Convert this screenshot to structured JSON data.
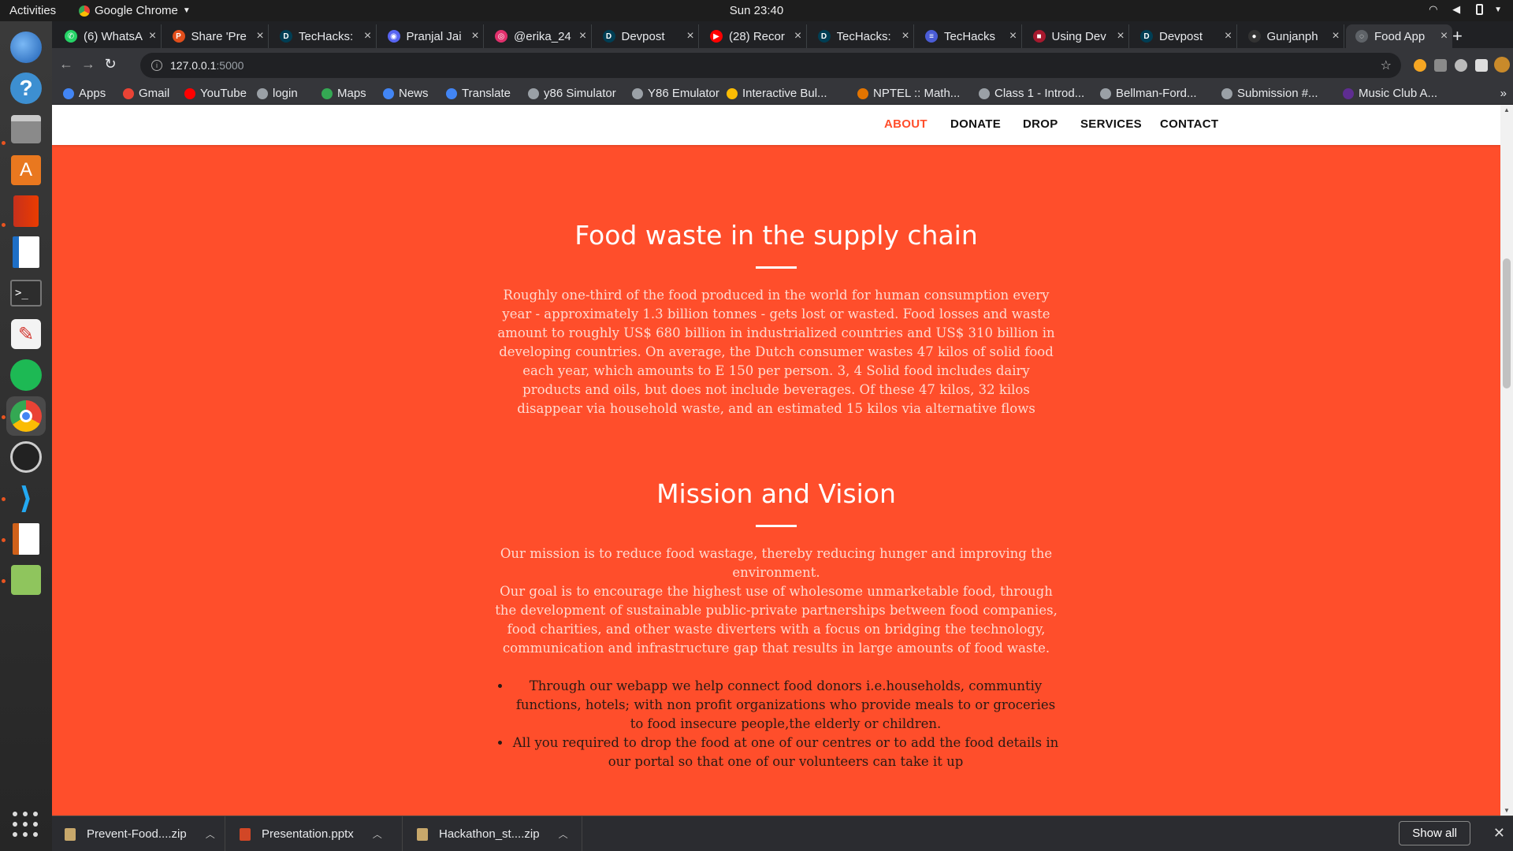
{
  "system": {
    "activities": "Activities",
    "app_name": "Google Chrome",
    "clock": "Sun 23:40"
  },
  "tabs": [
    {
      "title": "(6) WhatsA",
      "color": "#25d366",
      "glyph": "✆"
    },
    {
      "title": "Share 'Pre",
      "color": "#e24e1b",
      "glyph": "P"
    },
    {
      "title": "TecHacks:",
      "color": "#003e54",
      "glyph": "D"
    },
    {
      "title": "Pranjal Jai",
      "color": "#5865f2",
      "glyph": "◉"
    },
    {
      "title": "@erika_24",
      "color": "#e1306c",
      "glyph": "◎"
    },
    {
      "title": "Devpost",
      "color": "#003e54",
      "glyph": "D"
    },
    {
      "title": "(28) Recor",
      "color": "#ff0000",
      "glyph": "▶"
    },
    {
      "title": "TecHacks:",
      "color": "#003e54",
      "glyph": "D"
    },
    {
      "title": "TecHacks",
      "color": "#4a5cd6",
      "glyph": "≡"
    },
    {
      "title": "Using Dev",
      "color": "#a6192e",
      "glyph": "■"
    },
    {
      "title": "Devpost",
      "color": "#003e54",
      "glyph": "D"
    },
    {
      "title": "Gunjanph",
      "color": "#333333",
      "glyph": "●"
    },
    {
      "title": "Food App",
      "color": "#5f6368",
      "glyph": "◌"
    }
  ],
  "address": {
    "host": "127.0.0.1",
    "port": ":5000"
  },
  "bookmarks": [
    {
      "label": "Apps",
      "color": "#4285f4"
    },
    {
      "label": "Gmail",
      "color": "#ea4335"
    },
    {
      "label": "YouTube",
      "color": "#ff0000"
    },
    {
      "label": "login",
      "color": "#9aa0a6"
    },
    {
      "label": "Maps",
      "color": "#34a853"
    },
    {
      "label": "News",
      "color": "#4285f4"
    },
    {
      "label": "Translate",
      "color": "#4285f4"
    },
    {
      "label": "y86 Simulator",
      "color": "#9aa0a6"
    },
    {
      "label": "Y86 Emulator",
      "color": "#9aa0a6"
    },
    {
      "label": "Interactive Bul...",
      "color": "#fbbc04"
    },
    {
      "label": "NPTEL :: Math...",
      "color": "#e37400"
    },
    {
      "label": "Class 1 - Introd...",
      "color": "#9aa0a6"
    },
    {
      "label": "Bellman-Ford...",
      "color": "#9aa0a6"
    },
    {
      "label": "Submission #...",
      "color": "#9aa0a6"
    },
    {
      "label": "Music Club A...",
      "color": "#5e2d91"
    }
  ],
  "site": {
    "nav": [
      {
        "label": "ABOUT",
        "active": true
      },
      {
        "label": "DONATE",
        "active": false
      },
      {
        "label": "DROP",
        "active": false
      },
      {
        "label": "SERVICES",
        "active": false
      },
      {
        "label": "CONTACT",
        "active": false
      }
    ],
    "accent": "#ff4e2b",
    "waste": {
      "heading": "Food waste in the supply chain",
      "body": "Roughly one-third of the food produced in the world for human consumption every year - approximately 1.3 billion tonnes - gets lost or wasted. Food losses and waste amount to roughly US$ 680 billion in industrialized countries and US$ 310 billion in developing countries. On average, the Dutch consumer wastes 47 kilos of solid food each year, which amounts to E 150 per person. 3, 4 Solid food includes dairy products and oils, but does not include beverages. Of these 47 kilos, 32 kilos disappear via household waste, and an estimated 15 kilos via alternative flows"
    },
    "mission": {
      "heading": "Mission and Vision",
      "body1": "Our mission is to reduce food wastage, thereby reducing hunger and improving the environment.",
      "body2": "Our goal is to encourage the highest use of wholesome unmarketable food, through the development of sustainable public-private partnerships between food companies, food charities, and other waste diverters with a focus on bridging the technology, communication and infrastructure gap that results in large amounts of food waste.",
      "points": [
        "Through our webapp we help connect food donors i.e.households, communtiy functions, hotels; with non profit organizations who provide meals to or groceries to food insecure people,the elderly or children.",
        "All you required to drop the food at one of our centres or to add the food details in our portal so that one of our volunteers can take it up"
      ]
    }
  },
  "downloads": [
    {
      "name": "Prevent-Food....zip",
      "color": "#c8a86b"
    },
    {
      "name": "Presentation.pptx",
      "color": "#d24726"
    },
    {
      "name": "Hackathon_st....zip",
      "color": "#c8a86b"
    }
  ],
  "show_all": "Show all"
}
